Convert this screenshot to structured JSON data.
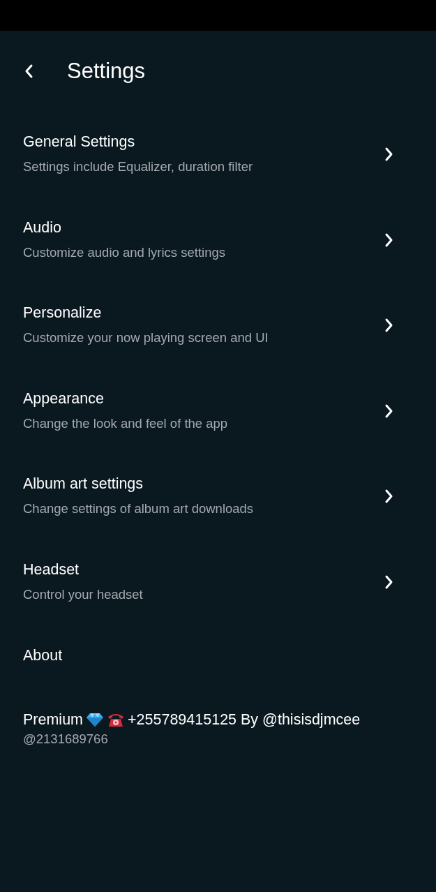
{
  "header": {
    "title": "Settings"
  },
  "items": [
    {
      "kind": "link",
      "title": "General Settings",
      "subtitle": "Settings include Equalizer, duration filter"
    },
    {
      "kind": "link",
      "title": "Audio",
      "subtitle": "Customize audio and lyrics settings"
    },
    {
      "kind": "link",
      "title": "Personalize",
      "subtitle": "Customize your now playing screen and UI"
    },
    {
      "kind": "link",
      "title": "Appearance",
      "subtitle": "Change the look and feel of the app"
    },
    {
      "kind": "link",
      "title": "Album art settings",
      "subtitle": "Change settings of album art downloads"
    },
    {
      "kind": "link",
      "title": "Headset",
      "subtitle": "Control your headset"
    },
    {
      "kind": "plain",
      "title": "About"
    },
    {
      "kind": "premium",
      "title": "Premium",
      "title_end": "+255789415125 By @thisisdjmcee",
      "subtitle": "@2131689766"
    }
  ]
}
